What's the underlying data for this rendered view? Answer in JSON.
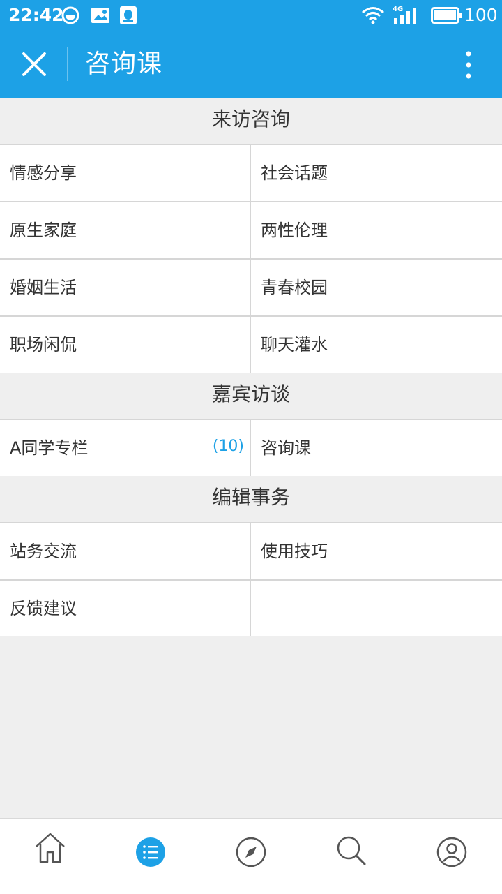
{
  "status_bar": {
    "time": "22:42",
    "network": "4G",
    "battery_percent": "100",
    "icons": [
      "sync-icon",
      "image-icon",
      "qq-icon",
      "wifi-icon",
      "signal-icon",
      "battery-icon"
    ]
  },
  "app_bar": {
    "title": "咨询课",
    "close_icon": "close-icon",
    "more_icon": "more-vertical-icon"
  },
  "sections": [
    {
      "title": "来访咨询",
      "items": [
        {
          "label": "情感分享"
        },
        {
          "label": "社会话题"
        },
        {
          "label": "原生家庭"
        },
        {
          "label": "两性伦理"
        },
        {
          "label": "婚姻生活"
        },
        {
          "label": "青春校园"
        },
        {
          "label": "职场闲侃"
        },
        {
          "label": "聊天灌水"
        }
      ]
    },
    {
      "title": "嘉宾访谈",
      "items": [
        {
          "label": "A同学专栏",
          "badge": "(10)"
        },
        {
          "label": "咨询课"
        }
      ]
    },
    {
      "title": "编辑事务",
      "items": [
        {
          "label": "站务交流"
        },
        {
          "label": "使用技巧"
        },
        {
          "label": "反馈建议"
        }
      ]
    }
  ],
  "bottom_nav": [
    {
      "icon": "home-icon",
      "active": false
    },
    {
      "icon": "list-icon",
      "active": true
    },
    {
      "icon": "compass-icon",
      "active": false
    },
    {
      "icon": "search-icon",
      "active": false
    },
    {
      "icon": "profile-icon",
      "active": false
    }
  ],
  "colors": {
    "primary": "#1da1e6",
    "background": "#efefef",
    "divider": "#d6d6d6",
    "text": "#333333",
    "icon_gray": "#555555"
  }
}
